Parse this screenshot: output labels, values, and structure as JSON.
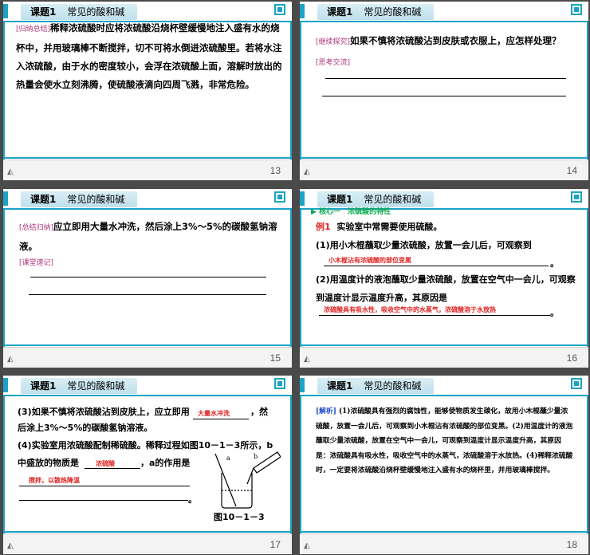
{
  "header": {
    "lesson": "课题1",
    "title": "常见的酸和碱"
  },
  "slides": {
    "s13": {
      "tag": "[归纳总结]",
      "text": "稀释浓硫酸时应将浓硫酸沿烧杯壁缓慢地注入盛有水的烧杯中，并用玻璃棒不断搅拌，切不可将水倒进浓硫酸里。若将水注入浓硫酸，由于水的密度较小，会浮在浓硫酸上面，溶解时放出的热量会使水立刻沸腾，使硫酸液滴向四周飞溅，非常危险。",
      "page": "13"
    },
    "s14": {
      "tag1": "[继续探究]",
      "question": "如果不慎将浓硫酸沾到皮肤或衣服上，应怎样处理？",
      "tag2": "[思考交流]",
      "page": "14"
    },
    "s15": {
      "tag1": "[总结归纳]",
      "text": "应立即用大量水冲洗，然后涂上3%～5%的碳酸氢钠溶液。",
      "tag2": "[课堂速记]",
      "page": "15"
    },
    "s16": {
      "core": "核心一　浓硫酸的特性",
      "ex_label": "例1",
      "ex_text": "实验室中常需要使用硫酸。",
      "q1": "(1)用小木棍蘸取少量浓硫酸，放置一会儿后，可观察到",
      "a1": "小木棍沾有浓硫酸的部位变黑",
      "q2": "(2)用温度计的液泡蘸取少量浓硫酸，放置在空气中一会儿，可观察到温度计显示温度升高，其原因是",
      "a2": "浓硫酸具有吸水性，吸收空气中的水蒸气，浓硫酸溶于水放热",
      "period": "。",
      "page": "16"
    },
    "s17": {
      "q3a": "(3)如果不慎将浓硫酸沾到皮肤上，应立即用",
      "a3": "大量水冲洗",
      "q3b": "，然后涂上3%～5%的碳酸氢钠溶液。",
      "q4": "(4)实验室用浓硫酸配制稀硫酸。稀释过程如图10－1－3所示，b中盛放的物质是",
      "a4a": "浓硫酸",
      "q4b": "，a的作用是",
      "a4b": "搅拌，以散热降温",
      "period": "。",
      "fig_a": "a",
      "fig_b": "b",
      "fig_caption": "图10－1－3",
      "page": "17"
    },
    "s18": {
      "tag": "[解析]",
      "text": "(1)浓硫酸具有强烈的腐蚀性，能够使物质发生碳化，故用小木棍蘸少量浓硫酸，放置一会儿后，可观察到小木棍沾有浓硫酸的部位变黑。(2)用温度计的液泡蘸取少量浓硫酸，放置在空气中一会儿，可观察到温度计显示温度升高，其原因是：浓硫酸具有吸水性，吸收空气中的水蒸气，浓硫酸溶于水放热。(4)稀释浓硫酸时，一定要将浓硫酸沿烧杯壁缓慢地注入盛有水的烧杯里，并用玻璃棒搅拌。",
      "page": "18"
    }
  },
  "colors": {
    "accent": "#1aa3c4",
    "tag": "#b0337a",
    "answer": "#e0201f",
    "core": "#0aa84e",
    "analysis": "#2050c8"
  },
  "icons": {
    "footer": "triangle-nav-icon",
    "corner": "corner-square-icon"
  }
}
